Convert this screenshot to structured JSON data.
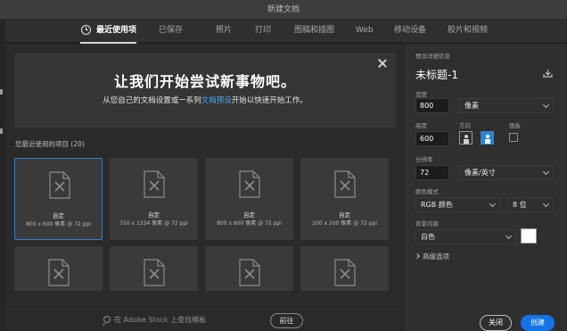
{
  "window": {
    "title": "新建文档"
  },
  "tabs": [
    {
      "label": "最近使用项"
    },
    {
      "label": "已保存"
    },
    {
      "label": "照片"
    },
    {
      "label": "打印"
    },
    {
      "label": "图稿和插图"
    },
    {
      "label": "Web"
    },
    {
      "label": "移动设备"
    },
    {
      "label": "胶片和视频"
    }
  ],
  "banner": {
    "title": "让我们开始尝试新事物吧。",
    "subtitle_before": "从您自己的文档设置或一系列",
    "subtitle_link": "文档预设",
    "subtitle_after": "开始以快速开始工作。"
  },
  "recent": {
    "title": "您最近使用的项目",
    "count": "(20)",
    "items": [
      {
        "name": "自定",
        "meta": "800 x 600 像素 @ 72 ppi"
      },
      {
        "name": "自定",
        "meta": "750 x 1334 像素 @ 72 ppi"
      },
      {
        "name": "自定",
        "meta": "800 x 800 像素 @ 72 ppi"
      },
      {
        "name": "自定",
        "meta": "200 x 200 像素 @ 72 ppi"
      }
    ]
  },
  "stock": {
    "placeholder": "在 Adobe Stock 上查找模板",
    "go_label": "前往"
  },
  "details": {
    "heading": "预设详细信息",
    "doc_name": "未标题-1",
    "width_label": "宽度",
    "width_value": "800",
    "width_unit": "像素",
    "height_label": "高度",
    "height_value": "600",
    "orientation_label": "方向",
    "artboard_label": "画板",
    "resolution_label": "分辨率",
    "resolution_value": "72",
    "resolution_unit": "像素/英寸",
    "color_mode_label": "颜色模式",
    "color_mode_value": "RGB 颜色",
    "bit_depth_value": "8 位",
    "background_label": "背景内容",
    "background_value": "白色",
    "background_color": "#ffffff",
    "advanced_label": "高级选项",
    "close_label": "关闭",
    "create_label": "创建"
  }
}
